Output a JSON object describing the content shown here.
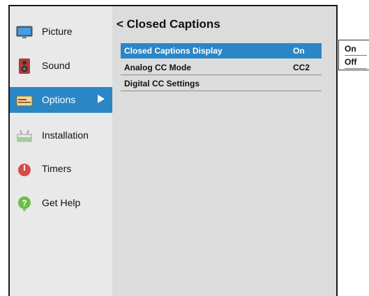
{
  "sidebar": {
    "items": [
      {
        "label": "Picture",
        "icon": "tv-icon"
      },
      {
        "label": "Sound",
        "icon": "speaker-icon"
      },
      {
        "label": "Options",
        "icon": "options-icon",
        "active": true
      },
      {
        "label": "Installation",
        "icon": "installation-icon"
      },
      {
        "label": "Timers",
        "icon": "timer-icon"
      },
      {
        "label": "Get Help",
        "icon": "help-icon"
      }
    ]
  },
  "main": {
    "title": "< Closed Captions",
    "rows": [
      {
        "label": "Closed Captions Display",
        "value": "On",
        "selected": true
      },
      {
        "label": "Analog CC Mode",
        "value": "CC2"
      },
      {
        "label": "Digital CC Settings",
        "value": ""
      }
    ]
  },
  "popup": {
    "options": [
      "On",
      "Off"
    ]
  },
  "colors": {
    "accent": "#2b86c5",
    "sidebar_bg": "#e9e9e9",
    "main_bg": "#dcdcdc"
  }
}
